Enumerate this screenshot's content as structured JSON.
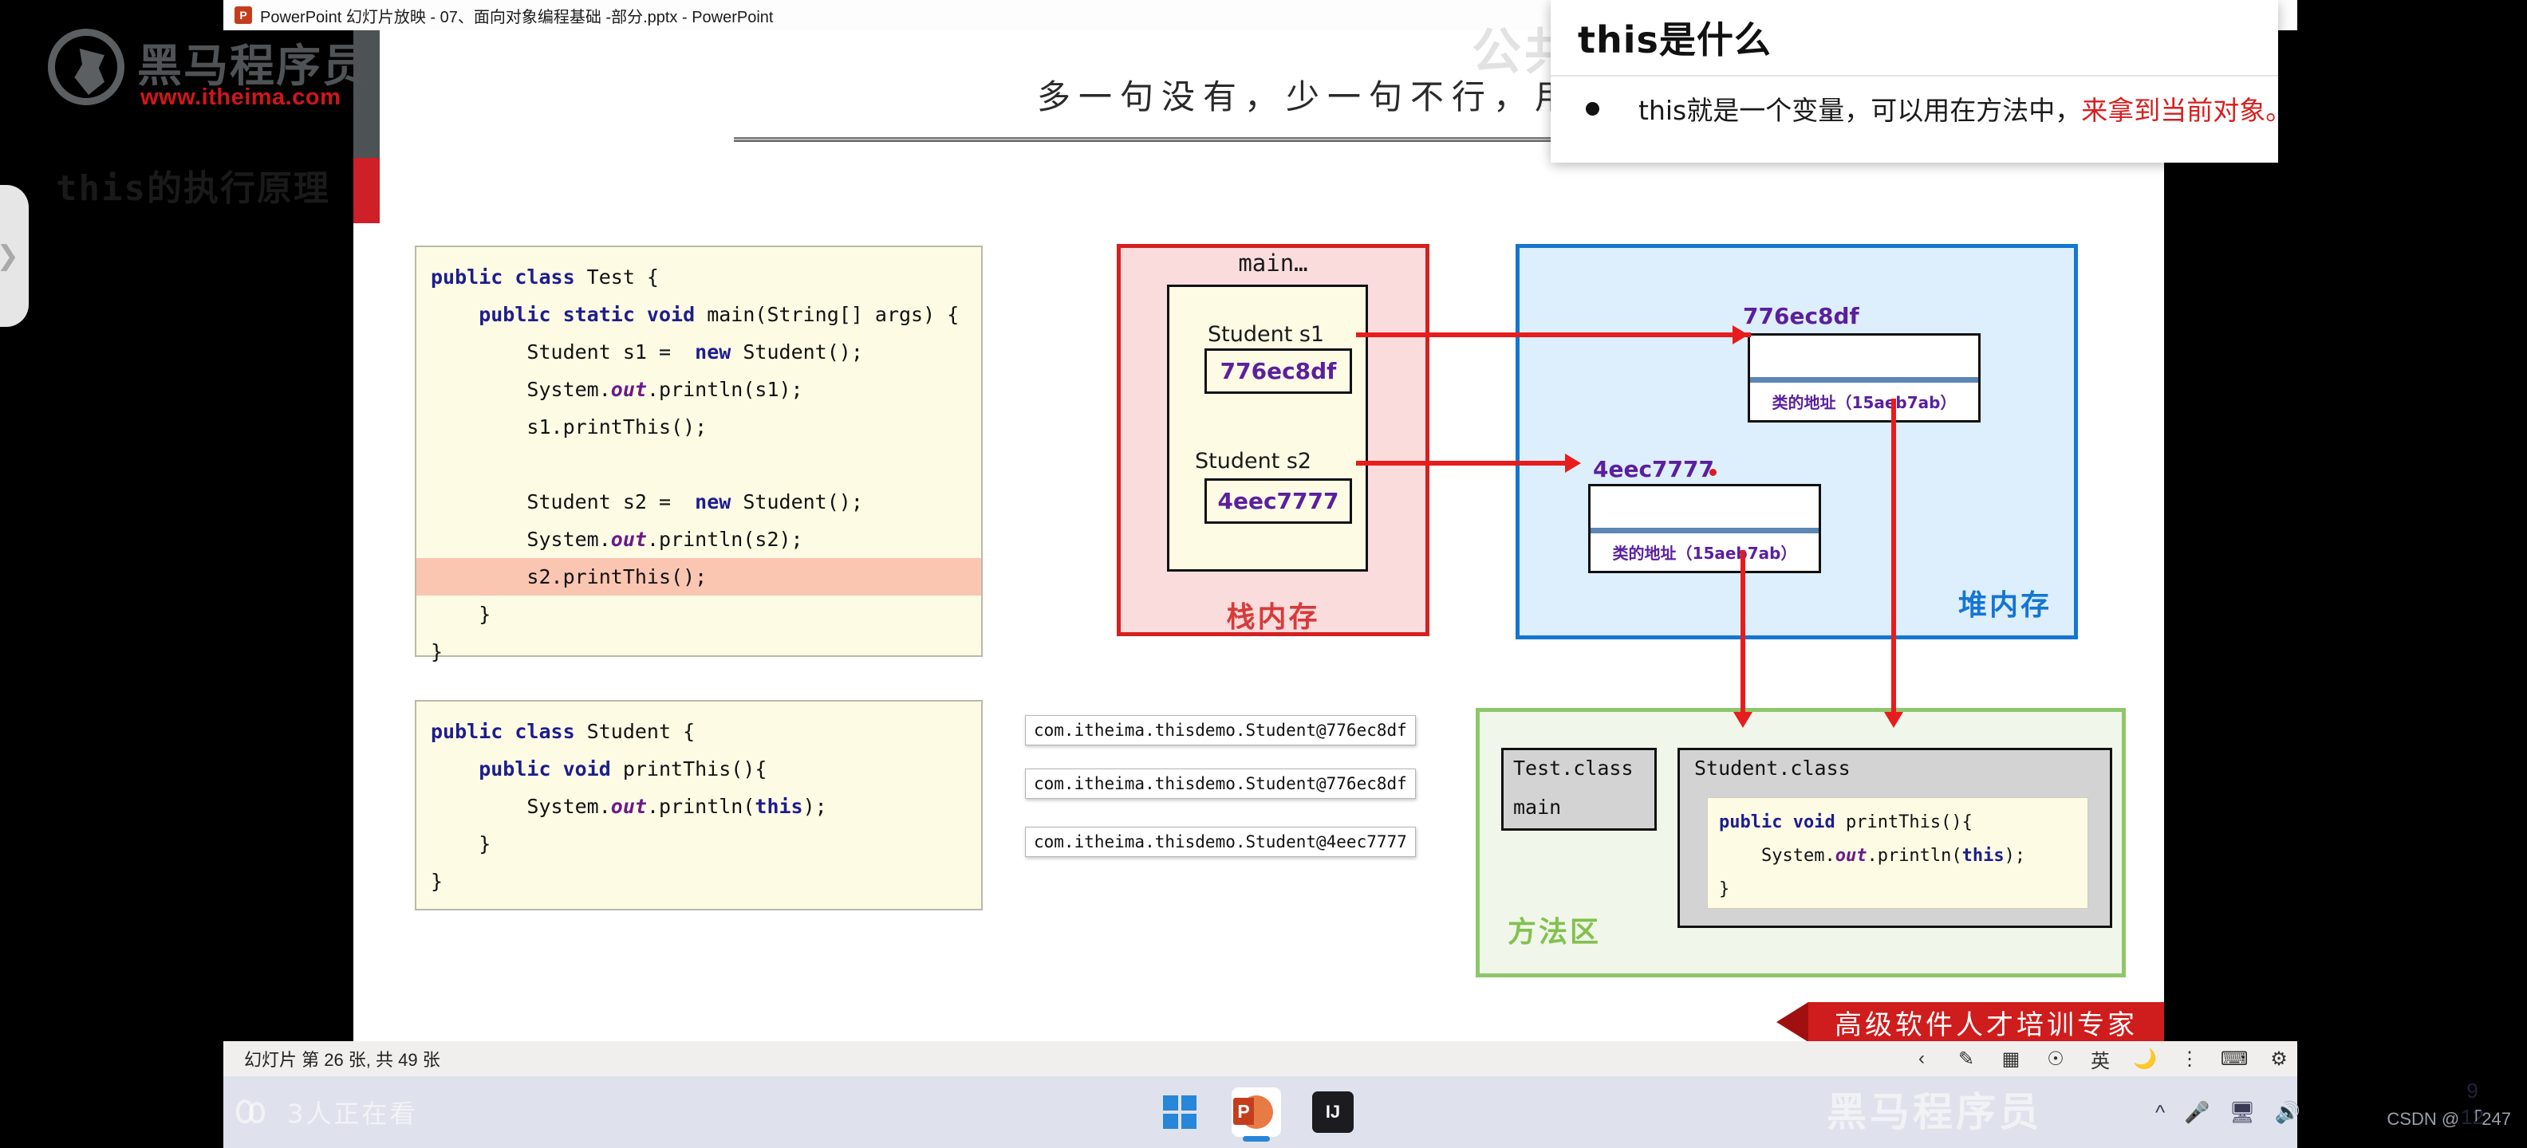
{
  "window": {
    "app_icon": "powerpoint-icon",
    "title": "PowerPoint 幻灯片放映  -  07、面向对象编程基础 -部分.pptx - PowerPoint"
  },
  "slide": {
    "logo_cn": "黑马程序员",
    "logo_url": "www.itheima.com",
    "header_caption": "多一句没有，少一句不行，用",
    "watermark": "公共方法",
    "title": "this的执行原理",
    "banner": "高级软件人才培训专家"
  },
  "code_test": {
    "lines": [
      [
        {
          "t": "public class ",
          "c": "kw"
        },
        {
          "t": "Test {",
          "c": ""
        }
      ],
      [
        {
          "t": "    public static void ",
          "c": "kw"
        },
        {
          "t": "main(String[] args) {",
          "c": ""
        }
      ],
      [
        {
          "t": "        Student s1 =  ",
          "c": ""
        },
        {
          "t": "new ",
          "c": "kw"
        },
        {
          "t": "Student();",
          "c": ""
        }
      ],
      [
        {
          "t": "        System.",
          "c": ""
        },
        {
          "t": "out",
          "c": "it"
        },
        {
          "t": ".println(s1);",
          "c": ""
        }
      ],
      [
        {
          "t": "        s1.printThis();",
          "c": ""
        }
      ],
      [
        {
          "t": " ",
          "c": ""
        }
      ],
      [
        {
          "t": "        Student s2 =  ",
          "c": ""
        },
        {
          "t": "new ",
          "c": "kw"
        },
        {
          "t": "Student();",
          "c": ""
        }
      ],
      [
        {
          "t": "        System.",
          "c": ""
        },
        {
          "t": "out",
          "c": "it"
        },
        {
          "t": ".println(s2);",
          "c": ""
        }
      ],
      [
        {
          "t": "        s2.printThis();",
          "c": ""
        }
      ],
      [
        {
          "t": "    }",
          "c": ""
        }
      ],
      [
        {
          "t": "}",
          "c": ""
        }
      ]
    ],
    "highlight_line": 8
  },
  "code_student": {
    "lines": [
      [
        {
          "t": "public class ",
          "c": "kw"
        },
        {
          "t": "Student {",
          "c": ""
        }
      ],
      [
        {
          "t": "    public void ",
          "c": "kw"
        },
        {
          "t": "printThis(){",
          "c": ""
        }
      ],
      [
        {
          "t": "        System.",
          "c": ""
        },
        {
          "t": "out",
          "c": "it"
        },
        {
          "t": ".println(",
          "c": ""
        },
        {
          "t": "this",
          "c": "kw"
        },
        {
          "t": ");",
          "c": ""
        }
      ],
      [
        {
          "t": "    }",
          "c": ""
        }
      ],
      [
        {
          "t": "}",
          "c": ""
        }
      ]
    ]
  },
  "console_outputs": [
    "com.itheima.thisdemo.Student@776ec8df",
    "com.itheima.thisdemo.Student@776ec8df",
    "com.itheima.thisdemo.Student@4eec7777"
  ],
  "stack": {
    "frame_label": "main…",
    "tag": "栈内存",
    "vars": [
      {
        "name": "Student  s1",
        "value": "776ec8df"
      },
      {
        "name": "Student  s2",
        "value": "4eec7777"
      }
    ]
  },
  "heap": {
    "tag": "堆内存",
    "objects": [
      {
        "addr": "776ec8df",
        "class_addr": "类的地址（15aeb7ab）"
      },
      {
        "addr": "4eec7777",
        "class_addr": "类的地址（15aeb7ab）"
      }
    ]
  },
  "method_area": {
    "tag": "方法区",
    "test_class": {
      "name": "Test.class",
      "member": "main"
    },
    "student_class": {
      "name": "Student.class",
      "lines": [
        [
          {
            "t": "public void ",
            "c": "kw"
          },
          {
            "t": "printThis(){",
            "c": ""
          }
        ],
        [
          {
            "t": "    System.",
            "c": ""
          },
          {
            "t": "out",
            "c": "it"
          },
          {
            "t": ".println(",
            "c": ""
          },
          {
            "t": "this",
            "c": "kw"
          },
          {
            "t": ");",
            "c": ""
          }
        ],
        [
          {
            "t": "}",
            "c": ""
          }
        ]
      ]
    }
  },
  "overlay": {
    "title": "this是什么",
    "bullet_prefix": "this就是一个变量，可以用在方法中，",
    "bullet_highlight": "来拿到当前对象。"
  },
  "status_bar": {
    "slide_counter": "幻灯片 第 26 张, 共 49 张",
    "icons": [
      "previous-icon",
      "pen-icon",
      "all-slides-icon",
      "zoom-icon",
      "ime-english-icon",
      "moon-icon",
      "cursor-icon",
      "keyboard-icon",
      "gear-icon"
    ],
    "ime_label": "英"
  },
  "taskbar": {
    "viewers": "3人正在看",
    "apps": [
      "windows-start-icon",
      "powerpoint-icon",
      "intellij-idea-icon"
    ],
    "tray": [
      "chevron-up-icon",
      "microphone-icon",
      "display-icon",
      "volume-icon"
    ],
    "watermark": "黑马程序员",
    "page_top": "9",
    "page_bottom": "12",
    "csdn": "CSDN @ 「247"
  },
  "left_tab": {
    "icon": "chevron-right-icon"
  },
  "colors": {
    "stack_border": "#d61f1f",
    "heap_border": "#1476d2",
    "method_border": "#8ec76a",
    "accent_red": "#e81c1c",
    "code_bg": "#fdfbe4",
    "highlight": "#fac6b2"
  }
}
